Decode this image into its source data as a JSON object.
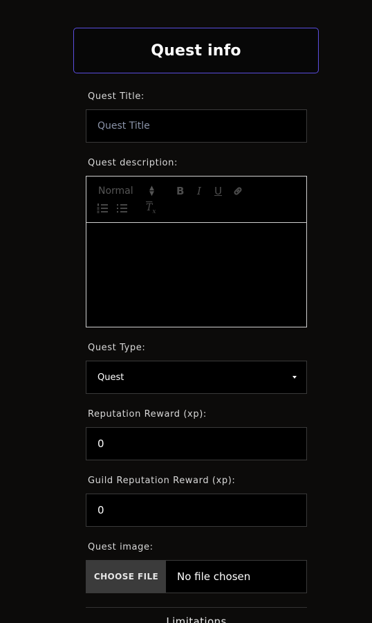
{
  "header": {
    "title": "Quest info"
  },
  "form": {
    "title": {
      "label": "Quest Title:",
      "placeholder": "Quest Title"
    },
    "description": {
      "label": "Quest description:",
      "toolbar": {
        "heading_select": "Normal",
        "bold": "B",
        "italic": "I",
        "underline": "U",
        "clear_format": "Tx"
      },
      "content": ""
    },
    "type": {
      "label": "Quest Type:",
      "value": "Quest"
    },
    "reputation": {
      "label": "Reputation Reward (xp):",
      "value": "0"
    },
    "guild_reputation": {
      "label": "Guild Reputation Reward (xp):",
      "value": "0"
    },
    "image": {
      "label": "Quest image:",
      "button": "CHOOSE FILE",
      "status": "No file chosen"
    }
  },
  "limitations": {
    "title": "Limitations"
  },
  "colors": {
    "accent": "#5b4ee0",
    "background": "#0c0b0a",
    "field": "#000000"
  }
}
